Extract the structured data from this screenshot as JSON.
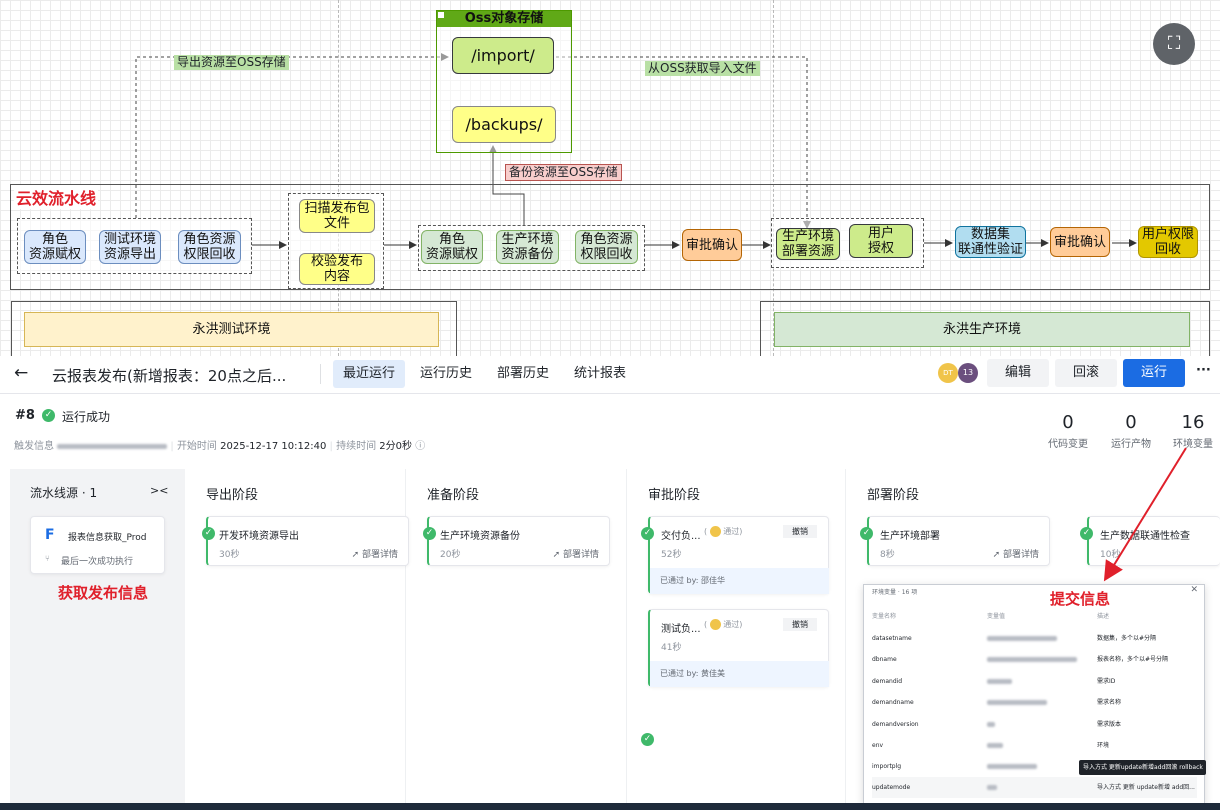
{
  "diagram": {
    "oss_title": "Oss对象存储",
    "import_box": "/import/",
    "backups_box": "/backups/",
    "label_export": "导出资源至OSS存储",
    "label_fetch": "从OSS获取导入文件",
    "label_backup": "备份资源至OSS存储",
    "pipeline_title": "云效流水线",
    "nodes": {
      "role_assign1": "角色\n资源赋权",
      "test_export": "测试环境\n资源导出",
      "role_revoke1": "角色资源\n权限回收",
      "scan_package": "扫描发布包\n文件",
      "verify_content": "校验发布\n内容",
      "role_assign2": "角色\n资源赋权",
      "prod_backup": "生产环境\n资源备份",
      "role_revoke2": "角色资源\n权限回收",
      "approve1": "审批确认",
      "prod_deploy": "生产环境\n部署资源",
      "user_auth": "用户\n授权",
      "dataset_verify": "数据集\n联通性验证",
      "approve2": "审批确认",
      "user_revoke": "用户权限\n回收"
    },
    "env_test": "永洪测试环境",
    "env_prod": "永洪生产环境",
    "icon": "screenshot-crop-icon"
  },
  "app": {
    "back_icon": "back-arrow-icon",
    "title": "云报表发布(新增报表：20点之后...",
    "tabs": [
      "最近运行",
      "运行历史",
      "部署历史",
      "统计报表"
    ],
    "active_tab": 0,
    "avatars": [
      "DT",
      "13"
    ],
    "buttons": {
      "edit": "编辑",
      "rollback": "回滚",
      "run": "运行",
      "more": "···"
    },
    "run_no": "#8",
    "run_status": "运行成功",
    "trigger_label": "触发信息",
    "start_label": "开始时间",
    "start_time": "2025-12-17 10:12:40",
    "duration_label": "持续时间",
    "duration": "2分0秒",
    "stats": [
      {
        "value": "0",
        "label": "代码变更"
      },
      {
        "value": "0",
        "label": "运行产物"
      },
      {
        "value": "16",
        "label": "环境变量"
      }
    ],
    "source": {
      "title": "流水线源 · 1",
      "collapse": ">< ",
      "name": "报表信息获取_Prod",
      "sub": "最后一次成功执行"
    },
    "annotation_left": "获取发布信息",
    "annotation_right": "提交信息",
    "stages": [
      {
        "name": "导出阶段",
        "jobs": [
          {
            "title": "开发环境资源导出",
            "dur": "30秒",
            "link": "部署详情"
          }
        ]
      },
      {
        "name": "准备阶段",
        "jobs": [
          {
            "title": "生产环境资源备份",
            "dur": "20秒",
            "link": "部署详情"
          }
        ]
      },
      {
        "name": "审批阶段",
        "jobs": [
          {
            "title": "交付负...",
            "badge": "通过",
            "btn": "撤销",
            "dur": "52秒",
            "by": "已通过 by: 邵佳华"
          },
          {
            "title": "测试负...",
            "badge": "通过",
            "btn": "撤销",
            "dur": "41秒",
            "by": "已通过 by: 黄佳美"
          }
        ]
      },
      {
        "name": "部署阶段",
        "jobs": [
          {
            "title": "生产环境部署",
            "dur": "8秒",
            "link": "部署详情"
          },
          {
            "title": "生产数据联通性检查",
            "dur": "10秒"
          }
        ]
      }
    ],
    "popup": {
      "title": "环境变量 · 16 项",
      "headers": [
        "变量名称",
        "变量值",
        "描述"
      ],
      "rows": [
        {
          "name": "datasetname",
          "desc": "数据集，多个以#分隔"
        },
        {
          "name": "dbname",
          "desc": "报表名称，多个以#号分隔"
        },
        {
          "name": "demandid",
          "desc": "需求ID"
        },
        {
          "name": "demandname",
          "desc": "需求名称"
        },
        {
          "name": "demandversion",
          "desc": "需求版本"
        },
        {
          "name": "env",
          "desc": "环境"
        },
        {
          "name": "importplg",
          "desc": ""
        },
        {
          "name": "updatemode",
          "desc": "导入方式 更新 update新增 add回..."
        }
      ],
      "tooltip": "导入方式 更新update新增add回滚 rollback"
    }
  }
}
